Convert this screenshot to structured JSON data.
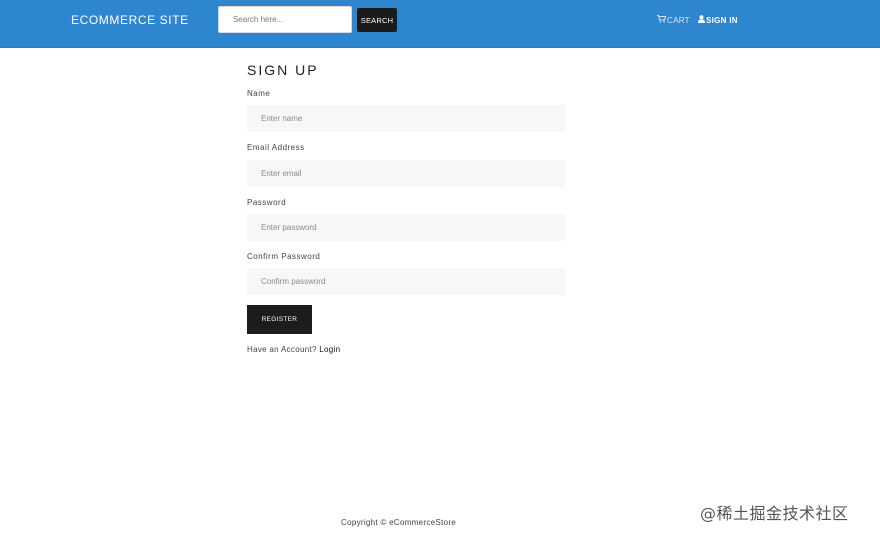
{
  "header": {
    "brand": "ECOMMERCE SITE",
    "search": {
      "placeholder": "Search here...",
      "value": ""
    },
    "search_button": "SEARCH",
    "cart_label": "CART",
    "signin_label": "SIGN IN"
  },
  "form": {
    "title": "SIGN UP",
    "fields": [
      {
        "label": "Name",
        "placeholder": "Enter name",
        "value": ""
      },
      {
        "label": "Email Address",
        "placeholder": "Enter email",
        "value": ""
      },
      {
        "label": "Password",
        "placeholder": "Enter password",
        "value": ""
      },
      {
        "label": "Confirm Password",
        "placeholder": "Confirm password",
        "value": ""
      }
    ],
    "register_button": "REGISTER",
    "have_account": "Have an Account?",
    "login_link": "Login"
  },
  "footer": {
    "copyright": "Copyright © eCommerceStore"
  },
  "watermark": "@稀土掘金技术社区",
  "icons": {
    "cart": "cart-icon",
    "user": "user-icon"
  },
  "colors": {
    "navbar": "#2e86cf",
    "button_dark": "#1c1c1c",
    "field_bg": "#f7f7f9"
  }
}
